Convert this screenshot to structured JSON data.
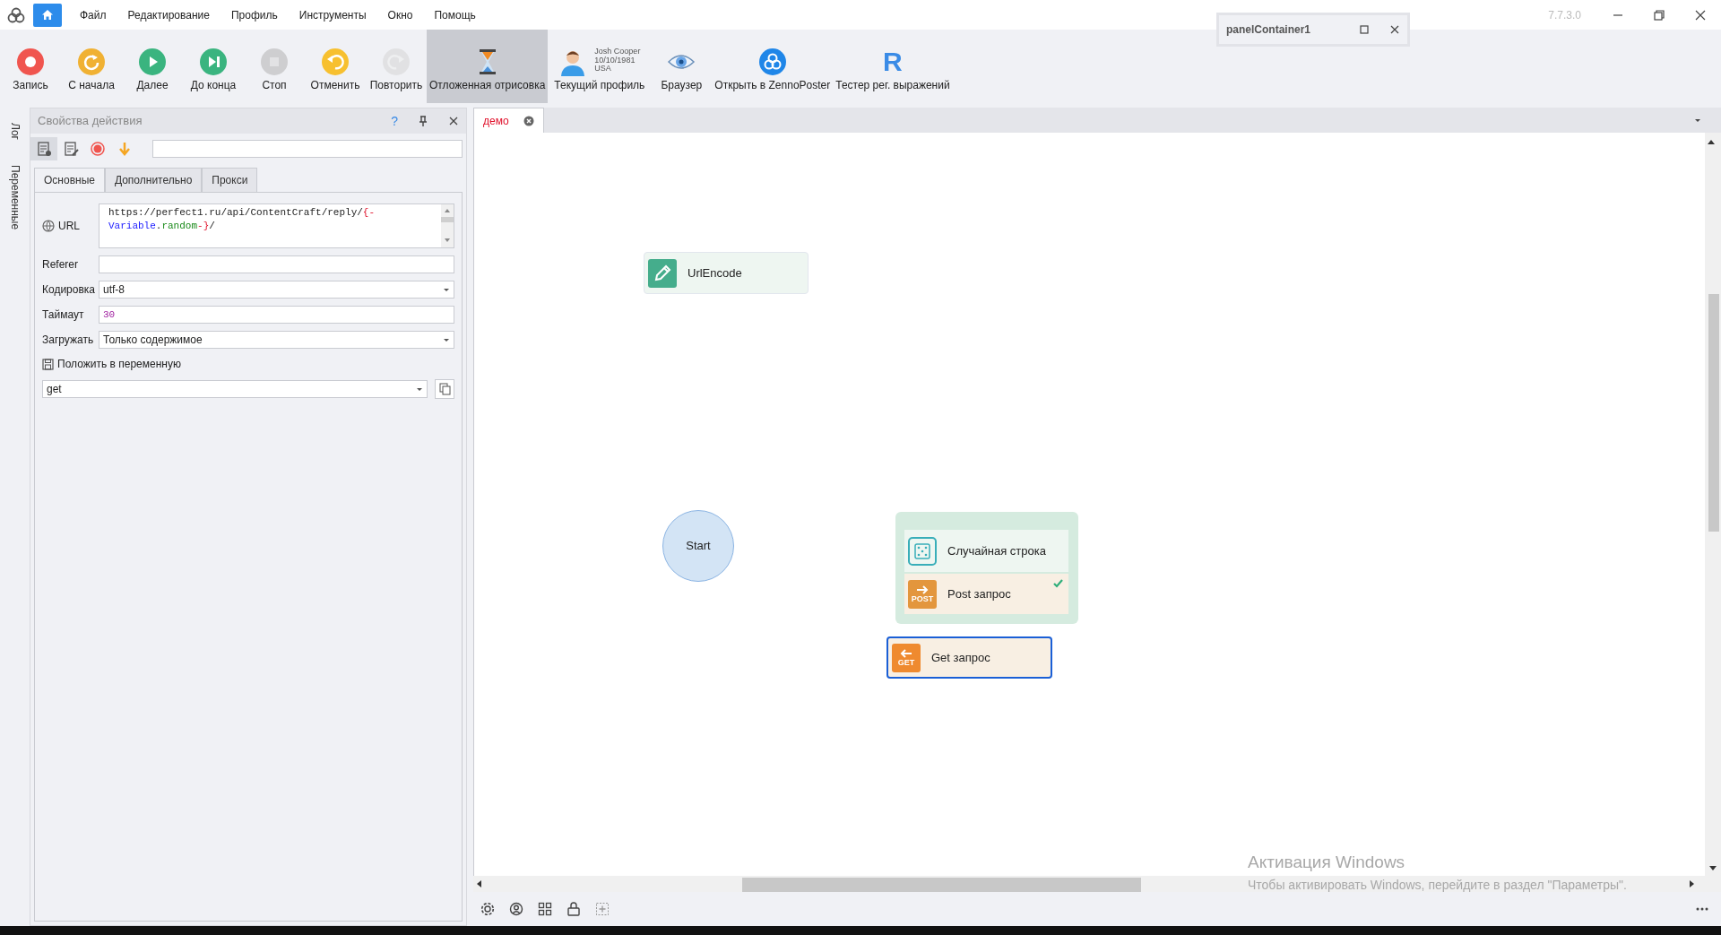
{
  "app": {
    "version": "7.7.3.0"
  },
  "menu": [
    "Файл",
    "Редактирование",
    "Профиль",
    "Инструменты",
    "Окно",
    "Помощь"
  ],
  "toolbar": [
    {
      "kind": "record",
      "label": "Запись",
      "disabled": false,
      "selected": false
    },
    {
      "kind": "restart",
      "label": "С начала",
      "disabled": false,
      "selected": false
    },
    {
      "kind": "next",
      "label": "Далее",
      "disabled": false,
      "selected": false
    },
    {
      "kind": "end",
      "label": "До конца",
      "disabled": false,
      "selected": false
    },
    {
      "kind": "stop",
      "label": "Стоп",
      "disabled": true,
      "selected": false
    },
    {
      "kind": "undo",
      "label": "Отменить",
      "disabled": false,
      "selected": false
    },
    {
      "kind": "redo",
      "label": "Повторить",
      "disabled": true,
      "selected": false
    },
    {
      "kind": "delay",
      "label": "Отложенная отрисовка",
      "disabled": false,
      "selected": true
    },
    {
      "kind": "profile",
      "label": "Текущий профиль",
      "name": "Josh Cooper",
      "birthdate": "10/10/1981",
      "country": "USA",
      "disabled": false,
      "selected": false
    },
    {
      "kind": "browser",
      "label": "Браузер",
      "disabled": false,
      "selected": false
    },
    {
      "kind": "zenno",
      "label": "Открыть в ZennoPoster",
      "disabled": false,
      "selected": false
    },
    {
      "kind": "regex",
      "label": "Тестер рег. выражений",
      "icon_text": "R",
      "disabled": false,
      "selected": false
    }
  ],
  "floating_panel": {
    "title": "panelContainer1"
  },
  "side_tabs": [
    "Лог",
    "Переменные"
  ],
  "properties_panel": {
    "title": "Свойства действия",
    "help": "?",
    "tabs": [
      {
        "label": "Основные",
        "selected": true
      },
      {
        "label": "Дополнительно",
        "selected": false
      },
      {
        "label": "Прокси",
        "selected": false
      }
    ],
    "url": {
      "label": "URL",
      "parts": [
        {
          "kind": "plain",
          "text": "https://perfect1.ru/api/ContentCraft/reply/"
        },
        {
          "kind": "brace",
          "text": "{-"
        },
        {
          "kind": "newline"
        },
        {
          "kind": "var",
          "text": "Variable"
        },
        {
          "kind": "plain",
          "text": "."
        },
        {
          "kind": "prop",
          "text": "random"
        },
        {
          "kind": "brace",
          "text": "-}"
        },
        {
          "kind": "plain",
          "text": "/"
        }
      ]
    },
    "fields": [
      {
        "kind": "text",
        "label": "Referer"
      },
      {
        "kind": "select",
        "label": "Кодировка",
        "value": "utf-8"
      },
      {
        "kind": "number",
        "label": "Таймаут",
        "value": "30"
      },
      {
        "kind": "select",
        "label": "Загружать",
        "value": "Только содержимое"
      }
    ],
    "save_label": "Положить в переменную",
    "variable": "get"
  },
  "document_tabs": [
    {
      "label": "демо",
      "selected": true
    }
  ],
  "canvas": {
    "nodes": [
      {
        "kind": "urlencode",
        "label": "UrlEncode",
        "selected": false
      },
      {
        "kind": "start",
        "label": "Start"
      },
      {
        "kind": "group",
        "children": [
          {
            "kind": "random",
            "label": "Случайная строка",
            "checked": false
          },
          {
            "kind": "post",
            "icon_text": "POST",
            "label": "Post запрос",
            "checked": true
          }
        ]
      },
      {
        "kind": "get",
        "icon_text": "GET",
        "label": "Get запрос",
        "selected": true
      }
    ]
  },
  "activation": {
    "title": "Активация Windows",
    "text": "Чтобы активировать Windows, перейдите в раздел \"Параметры\"."
  }
}
